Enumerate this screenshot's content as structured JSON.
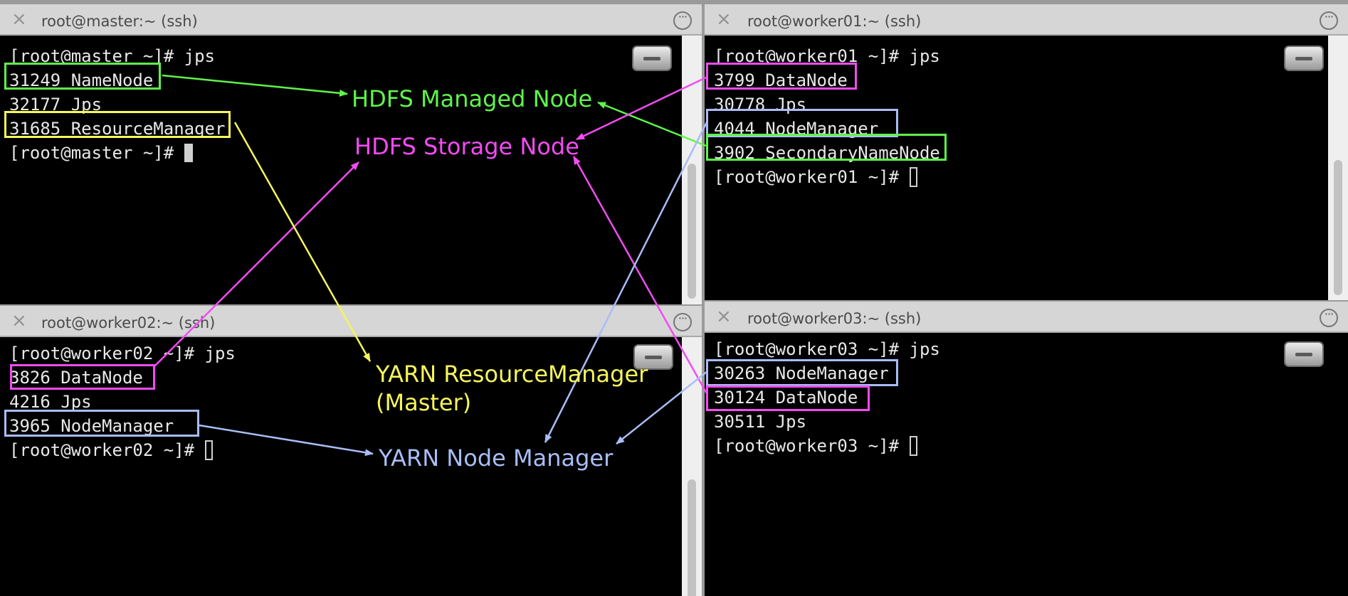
{
  "colors": {
    "namenode_green": "#5ef54a",
    "datanode_magenta": "#f24cf2",
    "resourcemanager_yellow": "#f6f55a",
    "nodemanager_blue": "#a9bdf6"
  },
  "windows": {
    "master": {
      "close_icon": "×",
      "title": "root@master:~ (ssh)",
      "lines": [
        "[root@master ~]# jps",
        "31249 NameNode",
        "32177 Jps",
        "31685 ResourceManager",
        "[root@master ~]# "
      ]
    },
    "worker01": {
      "close_icon": "×",
      "title": "root@worker01:~ (ssh)",
      "lines": [
        "[root@worker01 ~]# jps",
        "3799 DataNode",
        "30778 Jps",
        "4044 NodeManager",
        "3902 SecondaryNameNode",
        "[root@worker01 ~]# "
      ]
    },
    "worker02": {
      "close_icon": "×",
      "title": "root@worker02:~ (ssh)",
      "lines": [
        "[root@worker02 ~]# jps",
        "3826 DataNode",
        "4216 Jps",
        "3965 NodeManager",
        "[root@worker02 ~]# "
      ]
    },
    "worker03": {
      "close_icon": "×",
      "title": "root@worker03:~ (ssh)",
      "lines": [
        "[root@worker03 ~]# jps",
        "30263 NodeManager",
        "30124 DataNode",
        "30511 Jps",
        "[root@worker03 ~]# "
      ]
    }
  },
  "annotations": {
    "hdfs_managed": "HDFS Managed Node",
    "hdfs_storage": "HDFS Storage Node",
    "yarn_rm_line1": "YARN ResourceManager",
    "yarn_rm_line2": "(Master)",
    "yarn_nm": "YARN Node Manager"
  },
  "icons": [
    "close-icon",
    "more-options-icon",
    "disk-icon"
  ]
}
